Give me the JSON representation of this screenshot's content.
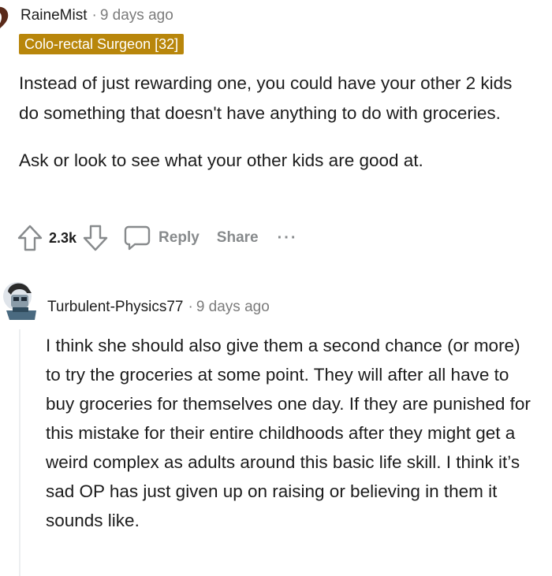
{
  "comment1": {
    "username": "RaineMist",
    "separator": "·",
    "timestamp": "9 days ago",
    "flair": "Colo-rectal Surgeon [32]",
    "paragraphs": [
      "Instead of just rewarding one, you could have your other 2 kids do something that doesn't have anything to do with groceries.",
      "Ask or look to see what your other kids are good at."
    ],
    "vote_count": "2.3k",
    "reply_label": "Reply",
    "share_label": "Share",
    "more_label": "···"
  },
  "comment2": {
    "username": "Turbulent-Physics77",
    "separator": "·",
    "timestamp": "9 days ago",
    "text": "I think she should also give them a second chance (or more) to try the groceries at some point. They will after all have to buy groceries for themselves one day. If they are punished for this mistake for their entire childhoods after they might get a weird complex as adults around this basic life skill. I think it’s sad OP has just given up on raising or believing in them it sounds like."
  },
  "colors": {
    "flair_bg": "#b8860b",
    "flair_text": "#ffffff",
    "meta_gray": "#7c7c7c",
    "action_gray": "#878a8c",
    "thread_line": "#edeff1"
  },
  "icons": [
    "upvote-icon",
    "downvote-icon",
    "comment-bubble-icon",
    "avatar-icon"
  ]
}
